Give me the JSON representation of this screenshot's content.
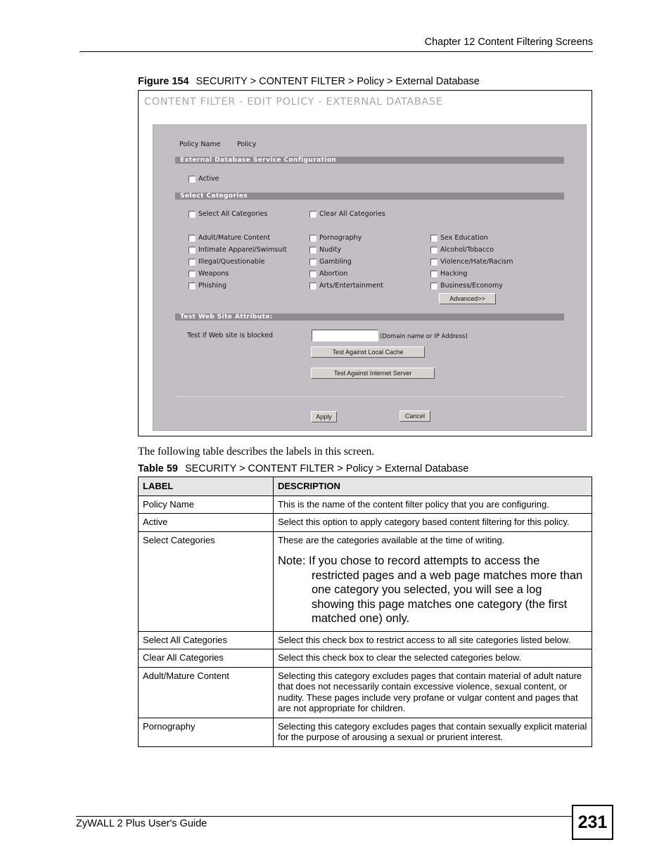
{
  "header": {
    "chapter": "Chapter 12 Content Filtering Screens"
  },
  "figure": {
    "number": "Figure 154",
    "caption": "SECURITY > CONTENT FILTER > Policy > External Database"
  },
  "screen": {
    "title": "CONTENT FILTER - EDIT POLICY - EXTERNAL DATABASE",
    "policy_name_label": "Policy Name",
    "policy_name_value": "Policy",
    "sections": {
      "external_db": "External Database Service Configuration",
      "select_categories": "Select Categories",
      "test_site": "Test Web Site Attribute:"
    },
    "active_label": "Active",
    "active_checked": false,
    "select_all_label": "Select All Categories",
    "clear_all_label": "Clear All Categories",
    "categories": [
      [
        "Adult/Mature Content",
        "Pornography",
        "Sex Education"
      ],
      [
        "Intimate Apparel/Swimsuit",
        "Nudity",
        "Alcohol/Tobacco"
      ],
      [
        "Illegal/Questionable",
        "Gambling",
        "Violence/Hate/Racism"
      ],
      [
        "Weapons",
        "Abortion",
        "Hacking"
      ],
      [
        "Phishing",
        "Arts/Entertainment",
        "Business/Economy"
      ]
    ],
    "advanced_button": "Advanced>>",
    "test_label": "Test if Web site is blocked",
    "test_input_value": "",
    "test_input_hint": "(Domain name or IP Address)",
    "test_local_button": "Test Against Local Cache",
    "test_internet_button": "Test Against Internet Server",
    "apply_button": "Apply",
    "cancel_button": "Cancel"
  },
  "intro_text": "The following table describes the labels in this screen.",
  "table": {
    "number": "Table 59",
    "caption": "SECURITY > CONTENT FILTER > Policy > External Database",
    "headers": [
      "LABEL",
      "DESCRIPTION"
    ],
    "rows": [
      {
        "label": "Policy Name",
        "description": "This is the name of the content filter policy that you are configuring."
      },
      {
        "label": "Active",
        "description": "Select this option to apply category based content filtering for this policy."
      },
      {
        "label": "Select Categories",
        "description": "These are the categories available at the time of writing.",
        "note": "Note: If you chose to record attempts to access the restricted pages and a web page matches more than one category you selected, you will see a log showing this page matches one category (the first matched one) only."
      },
      {
        "label": "Select All Categories",
        "description": "Select this check box to restrict access to all site categories listed below."
      },
      {
        "label": "Clear All Categories",
        "description": "Select this check box to clear the selected categories below."
      },
      {
        "label": "Adult/Mature Content",
        "description": "Selecting this category excludes pages that contain material of adult nature that does not necessarily contain excessive violence, sexual content, or nudity. These pages include very profane or vulgar content and pages that are not appropriate for children."
      },
      {
        "label": "Pornography",
        "description": "Selecting this category excludes pages that contain sexually explicit material for the purpose of arousing a sexual or prurient interest."
      }
    ]
  },
  "footer": {
    "guide_title": "ZyWALL 2 Plus User's Guide",
    "page_number": "231"
  }
}
